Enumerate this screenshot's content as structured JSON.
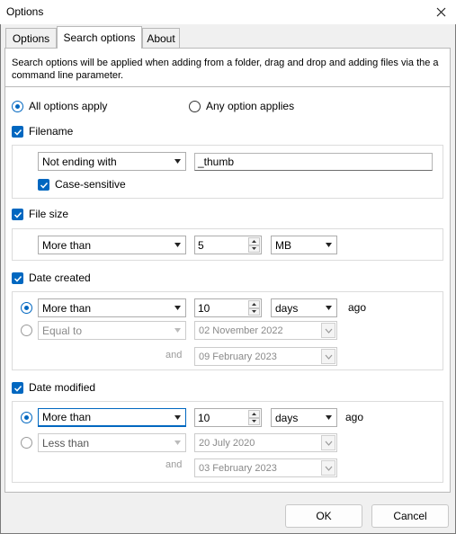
{
  "window": {
    "title": "Options"
  },
  "tabs": [
    {
      "label": "Options"
    },
    {
      "label": "Search options"
    },
    {
      "label": "About"
    }
  ],
  "description": "Search options will be applied when adding from a folder, drag and drop and adding files via the a command line parameter.",
  "match_mode": {
    "all_label": "All options apply",
    "any_label": "Any option applies",
    "selected": "all"
  },
  "filename": {
    "label": "Filename",
    "checked": true,
    "condition": "Not ending with",
    "value": "_thumb",
    "case_sensitive_label": "Case-sensitive",
    "case_sensitive": true
  },
  "file_size": {
    "label": "File size",
    "checked": true,
    "condition": "More than",
    "value": "5",
    "unit": "MB"
  },
  "date_created": {
    "label": "Date created",
    "checked": true,
    "relative": {
      "condition": "More than",
      "value": "10",
      "unit": "days",
      "suffix": "ago"
    },
    "absolute": {
      "condition": "Equal to",
      "from": "02 November 2022",
      "and_label": "and",
      "to": "09 February 2023"
    },
    "selected": "relative"
  },
  "date_modified": {
    "label": "Date modified",
    "checked": true,
    "relative": {
      "condition": "More than",
      "value": "10",
      "unit": "days",
      "suffix": "ago"
    },
    "absolute": {
      "condition": "Less than",
      "from": "20 July 2020",
      "and_label": "and",
      "to": "03 February 2023"
    },
    "selected": "relative"
  },
  "footer": {
    "ok_label": "OK",
    "cancel_label": "Cancel"
  },
  "colors": {
    "accent": "#0067c0",
    "disabled_text": "#8a8a8a"
  }
}
